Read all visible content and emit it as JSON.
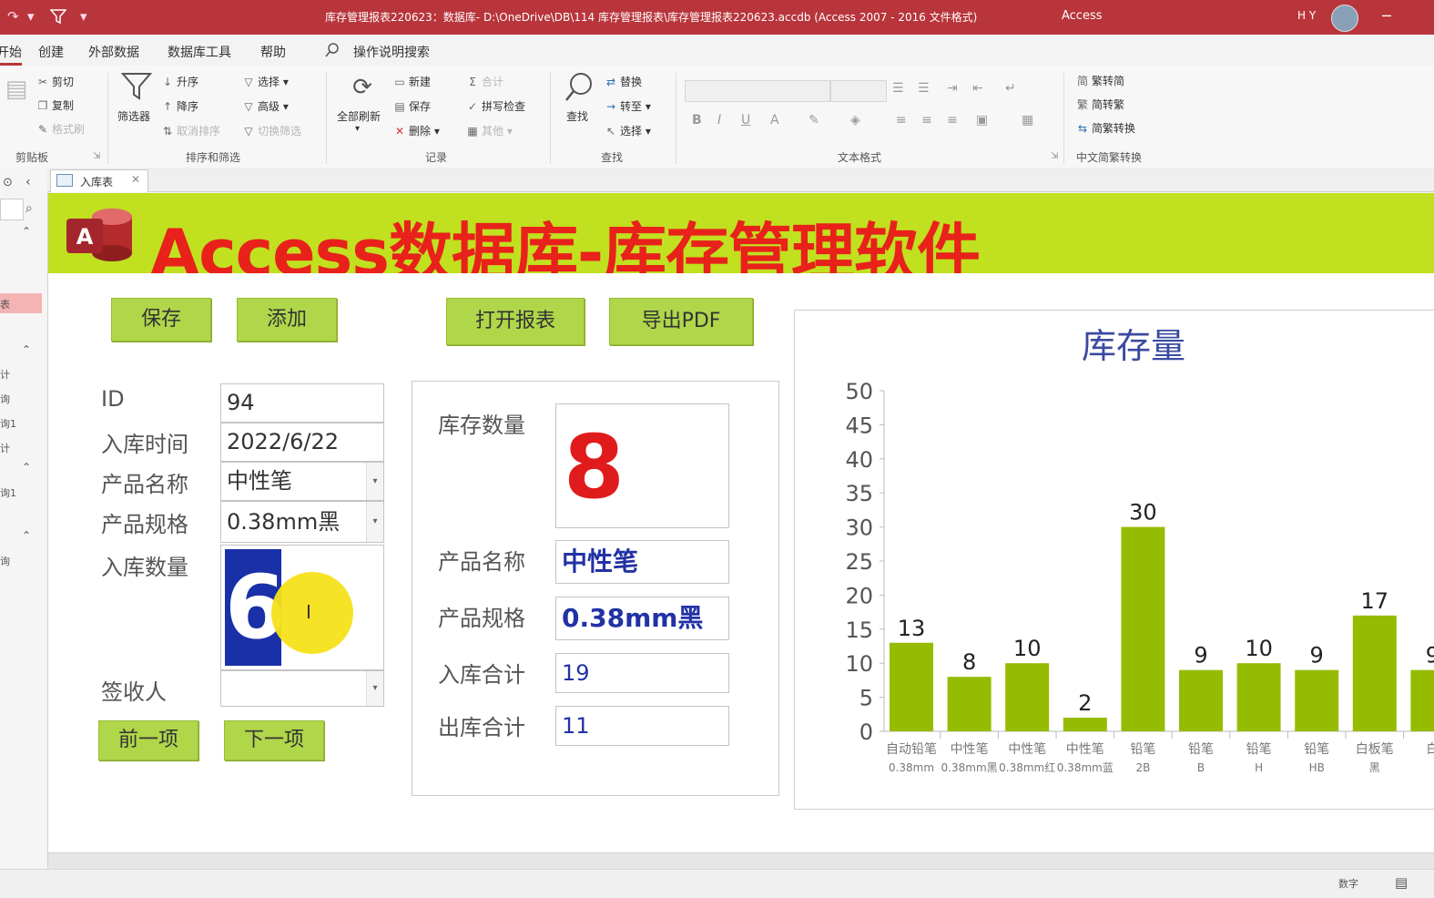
{
  "titlebar": {
    "title": "库存管理报表220623：数据库- D:\\OneDrive\\DB\\114 库存管理报表\\库存管理报表220623.accdb (Access 2007 - 2016 文件格式)",
    "app": "Access",
    "user": "H Y"
  },
  "menu": {
    "home": "开始",
    "create": "创建",
    "external": "外部数据",
    "dbtools": "数据库工具",
    "help": "帮助",
    "search": "操作说明搜索"
  },
  "ribbon": {
    "clipboard": {
      "cut": "剪切",
      "copy": "复制",
      "format_painter": "格式刷",
      "group": "剪贴板"
    },
    "sort": {
      "filter": "筛选器",
      "asc": "升序",
      "desc": "降序",
      "remove_sort": "取消排序",
      "selection": "选择",
      "advanced": "高级",
      "toggle_filter": "切换筛选",
      "group": "排序和筛选"
    },
    "records": {
      "refresh": "全部刷新",
      "new": "新建",
      "save": "保存",
      "delete": "删除",
      "totals": "合计",
      "spelling": "拼写检查",
      "more": "其他",
      "group": "记录"
    },
    "find": {
      "find": "查找",
      "replace": "替换",
      "goto": "转至",
      "select": "选择",
      "group": "查找"
    },
    "text": {
      "bold": "B",
      "italic": "I",
      "underline": "U",
      "font_color": "A",
      "group": "文本格式"
    },
    "chinese": {
      "t2s": "繁转简",
      "s2t": "简转繁",
      "convert": "简繁转换",
      "group": "中文简繁转换"
    }
  },
  "nav": {
    "items": [
      "表",
      "计",
      "询",
      "询1",
      "计",
      "询1",
      "询"
    ]
  },
  "tab": {
    "label": "入库表"
  },
  "form": {
    "banner_title": "Access数据库-库存管理软件",
    "logo_letter": "A",
    "buttons": {
      "save": "保存",
      "add": "添加",
      "open_report": "打开报表",
      "export_pdf": "导出PDF",
      "prev": "前一项",
      "next": "下一项"
    },
    "labels": {
      "id": "ID",
      "date": "入库时间",
      "product": "产品名称",
      "spec": "产品规格",
      "qty": "入库数量",
      "receiver": "签收人"
    },
    "values": {
      "id": "94",
      "date": "2022/6/22",
      "product": "中性笔",
      "spec": "0.38mm黑",
      "qty": "6",
      "receiver": ""
    },
    "stats": {
      "labels": {
        "stock": "库存数量",
        "product": "产品名称",
        "spec": "产品规格",
        "in_total": "入库合计",
        "out_total": "出库合计"
      },
      "values": {
        "stock": "8",
        "product": "中性笔",
        "spec": "0.38mm黑",
        "in_total": "19",
        "out_total": "11"
      }
    }
  },
  "chart_data": {
    "type": "bar",
    "title": "库存量",
    "categories": [
      [
        "自动铅笔",
        "0.38mm"
      ],
      [
        "中性笔",
        "0.38mm黑"
      ],
      [
        "中性笔",
        "0.38mm红"
      ],
      [
        "中性笔",
        "0.38mm蓝"
      ],
      [
        "铅笔",
        "2B"
      ],
      [
        "铅笔",
        "B"
      ],
      [
        "铅笔",
        "H"
      ],
      [
        "铅笔",
        "HB"
      ],
      [
        "白板笔",
        "黑"
      ],
      [
        "白",
        ""
      ]
    ],
    "values": [
      13,
      8,
      10,
      2,
      30,
      9,
      10,
      9,
      17,
      9
    ],
    "ylim": [
      0,
      50
    ],
    "yticks": [
      0,
      5,
      10,
      15,
      20,
      25,
      30,
      35,
      40,
      45,
      50
    ],
    "bar_color": "#95bc00"
  },
  "status": {
    "mode": "数字"
  }
}
